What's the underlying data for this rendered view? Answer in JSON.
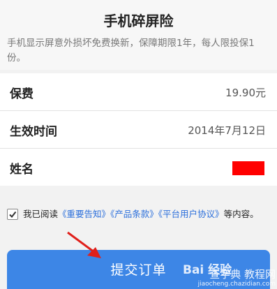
{
  "header": {
    "title": "手机碎屏险",
    "description": "手机显示屏意外损坏免费换新，保障期限1年，每人限投保1份。"
  },
  "rows": [
    {
      "label": "保费",
      "value": "19.90元"
    },
    {
      "label": "生效时间",
      "value": "2014年7月12日"
    },
    {
      "label": "姓名",
      "value": ""
    }
  ],
  "agreement": {
    "checked": true,
    "prefix": "我已阅读",
    "links": [
      "《重要告知》",
      "《产品条款》",
      "《平台用户协议》"
    ],
    "suffix": "等内容。"
  },
  "submit": {
    "label": "提交订单"
  },
  "watermark": {
    "logo": "Bai 经验",
    "site": "查字典 教程网",
    "url": "jiaocheng.chazidian.com"
  },
  "colors": {
    "accent": "#3d86e6",
    "link": "#2a6edb",
    "redacted": "#ff0000",
    "annotation_arrow": "#e0201b"
  },
  "icons": [
    "check-icon",
    "annotation-arrow-icon"
  ]
}
